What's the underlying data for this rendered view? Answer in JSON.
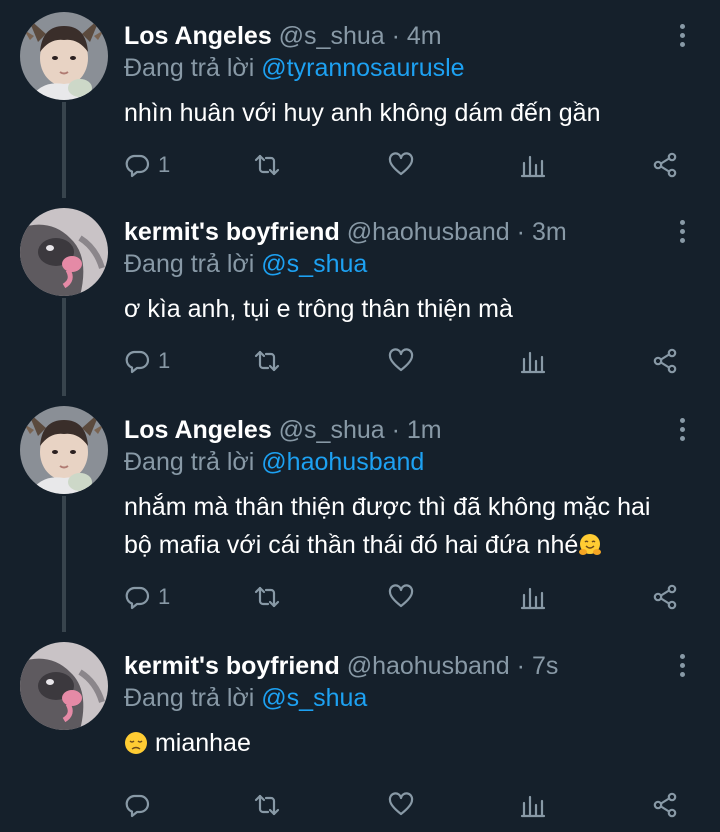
{
  "tweets": [
    {
      "name": "Los Angeles",
      "handle": "@s_shua",
      "separator": "·",
      "time": "4m",
      "replying_prefix": "Đang trả lời",
      "replying_to": "@tyrannosaurusle",
      "text": "nhìn huân với huy anh không dám đến gần",
      "reply_count": "1",
      "avatar": "person-avatar"
    },
    {
      "name": "kermit's boyfriend",
      "handle": "@haohusband",
      "separator": "·",
      "time": "3m",
      "replying_prefix": "Đang trả lời",
      "replying_to": "@s_shua",
      "text": "ơ kìa anh, tụi e trông thân thiện mà",
      "reply_count": "1",
      "avatar": "cat-avatar"
    },
    {
      "name": "Los Angeles",
      "handle": "@s_shua",
      "separator": "·",
      "time": "1m",
      "replying_prefix": "Đang trả lời",
      "replying_to": "@haohusband",
      "text_line1": "nhắm mà thân thiện được thì đã không mặc hai",
      "text_line2": "bộ mafia với cái thần thái đó hai đứa nhé",
      "text_emoji": "hugging-face-emoji",
      "reply_count": "1",
      "avatar": "person-avatar"
    },
    {
      "name": "kermit's boyfriend",
      "handle": "@haohusband",
      "separator": "·",
      "time": "7s",
      "replying_prefix": "Đang trả lời",
      "replying_to": "@s_shua",
      "text_emoji": "disappointed-face-emoji",
      "text": "mianhae",
      "reply_count": "",
      "avatar": "cat-avatar"
    }
  ],
  "colors": {
    "background": "#15202b",
    "muted": "#8899a6",
    "link": "#1da1f2",
    "thread_line": "#38444d"
  }
}
